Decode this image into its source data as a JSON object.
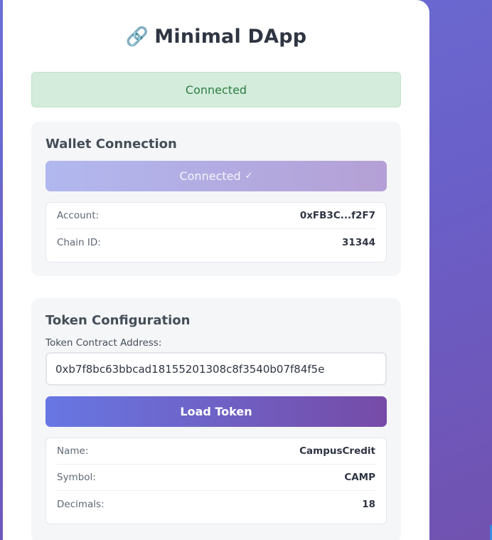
{
  "app": {
    "title": "Minimal DApp",
    "title_icon": "🔗"
  },
  "status": {
    "text": "Connected",
    "color": "#2e7d43"
  },
  "wallet": {
    "heading": "Wallet Connection",
    "button_label": "Connected",
    "button_check": "✓",
    "account_label": "Account:",
    "account_value": "0xFB3C...f2F7",
    "chain_label": "Chain ID:",
    "chain_value": "31344"
  },
  "token": {
    "heading": "Token Configuration",
    "address_label": "Token Contract Address:",
    "address_value": "0xb7f8bc63bbcad18155201308c8f3540b07f84f5e",
    "load_button_label": "Load Token",
    "name_label": "Name:",
    "name_value": "CampusCredit",
    "symbol_label": "Symbol:",
    "symbol_value": "CAMP",
    "decimals_label": "Decimals:",
    "decimals_value": "18"
  },
  "colors": {
    "accent_start": "#6777e3",
    "accent_end": "#764ba7",
    "success_bg": "#d4ecdc"
  }
}
